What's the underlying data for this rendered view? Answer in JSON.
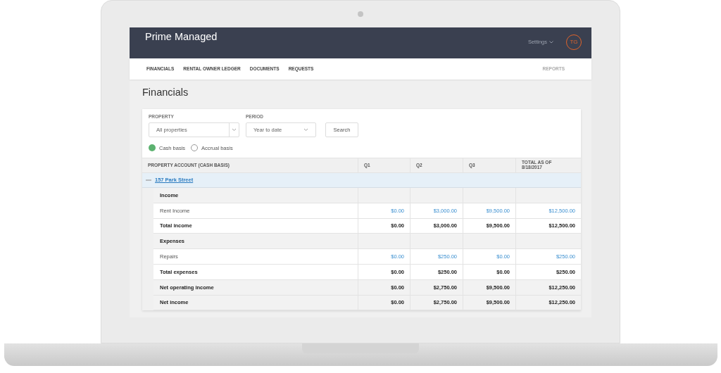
{
  "header": {
    "title": "Prime Managed",
    "settings": "Settings",
    "avatar": "TG"
  },
  "nav": {
    "items": [
      "FINANCIALS",
      "RENTAL OWNER LEDGER",
      "DOCUMENTS",
      "REQUESTS"
    ],
    "right": "REPORTS"
  },
  "page_title": "Financials",
  "filters": {
    "property": {
      "label": "PROPERTY",
      "value": "All properties"
    },
    "period": {
      "label": "PERIOD",
      "value": "Year to date"
    },
    "search_button": "Search"
  },
  "basis": [
    {
      "label": "Cash basis",
      "selected": true
    },
    {
      "label": "Accrual basis",
      "selected": false
    }
  ],
  "table": {
    "columns": [
      "PROPERTY ACCOUNT (CASH BASIS)",
      "Q1",
      "Q2",
      "Q3",
      "TOTAL AS OF 8/18/2017"
    ],
    "group": {
      "label": "157 Park Street",
      "expanded": true
    },
    "rows": [
      {
        "kind": "section",
        "label": "Income"
      },
      {
        "kind": "account",
        "label": "Rent Income",
        "values": [
          "$0.00",
          "$3,000.00",
          "$9,500.00",
          "$12,500.00"
        ]
      },
      {
        "kind": "total",
        "label": "Total income",
        "values": [
          "$0.00",
          "$3,000.00",
          "$9,500.00",
          "$12,500.00"
        ]
      },
      {
        "kind": "section",
        "label": "Expenses"
      },
      {
        "kind": "account",
        "label": "Repairs",
        "values": [
          "$0.00",
          "$250.00",
          "$0.00",
          "$250.00"
        ]
      },
      {
        "kind": "total",
        "label": "Total expenses",
        "values": [
          "$0.00",
          "$250.00",
          "$0.00",
          "$250.00"
        ]
      },
      {
        "kind": "summary",
        "label": "Net operating income",
        "values": [
          "$0.00",
          "$2,750.00",
          "$9,500.00",
          "$12,250.00"
        ]
      },
      {
        "kind": "summary",
        "label": "Net income",
        "values": [
          "$0.00",
          "$2,750.00",
          "$9,500.00",
          "$12,250.00"
        ]
      }
    ]
  }
}
